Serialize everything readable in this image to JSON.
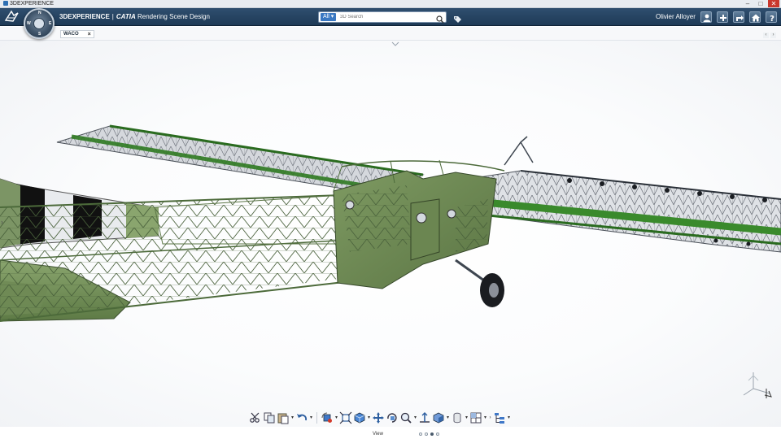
{
  "os": {
    "title": "3DEXPERIENCE",
    "controls": [
      "–",
      "□",
      "✕"
    ]
  },
  "app": {
    "brand": "3DEXPERIENCE",
    "separator": "|",
    "product": "CATIA",
    "app_name": "Rendering Scene Design",
    "user": "Olivier Alloyer"
  },
  "search": {
    "scope": "All ▾",
    "placeholder": "3D Search"
  },
  "compass": {
    "n": "N",
    "s": "S",
    "e": "E",
    "w": "W"
  },
  "tabs": [
    {
      "label": "WACO",
      "close": "×"
    }
  ],
  "tab_nav": [
    "‹",
    "›"
  ],
  "viewport": {
    "left_handle": "›"
  },
  "action_bar": {
    "section_label": "View",
    "active_page": 3,
    "pages": 4,
    "tools": [
      "cut-icon",
      "copy-icon",
      "paste-icon",
      "undo-icon",
      "spin-icon",
      "fit-all-icon",
      "cube-view-icon",
      "pan-icon",
      "rotate-icon",
      "zoom-icon",
      "normal-view-icon",
      "view-mode-icon",
      "hide-show-icon",
      "layout-icon",
      "tree-icon"
    ]
  },
  "colors": {
    "app_bar": "#25425f",
    "fabric_green": "#6f8f56",
    "frame_green": "#5f7a46",
    "wing_green": "#3f8a2f",
    "stripe_black": "#111111"
  }
}
